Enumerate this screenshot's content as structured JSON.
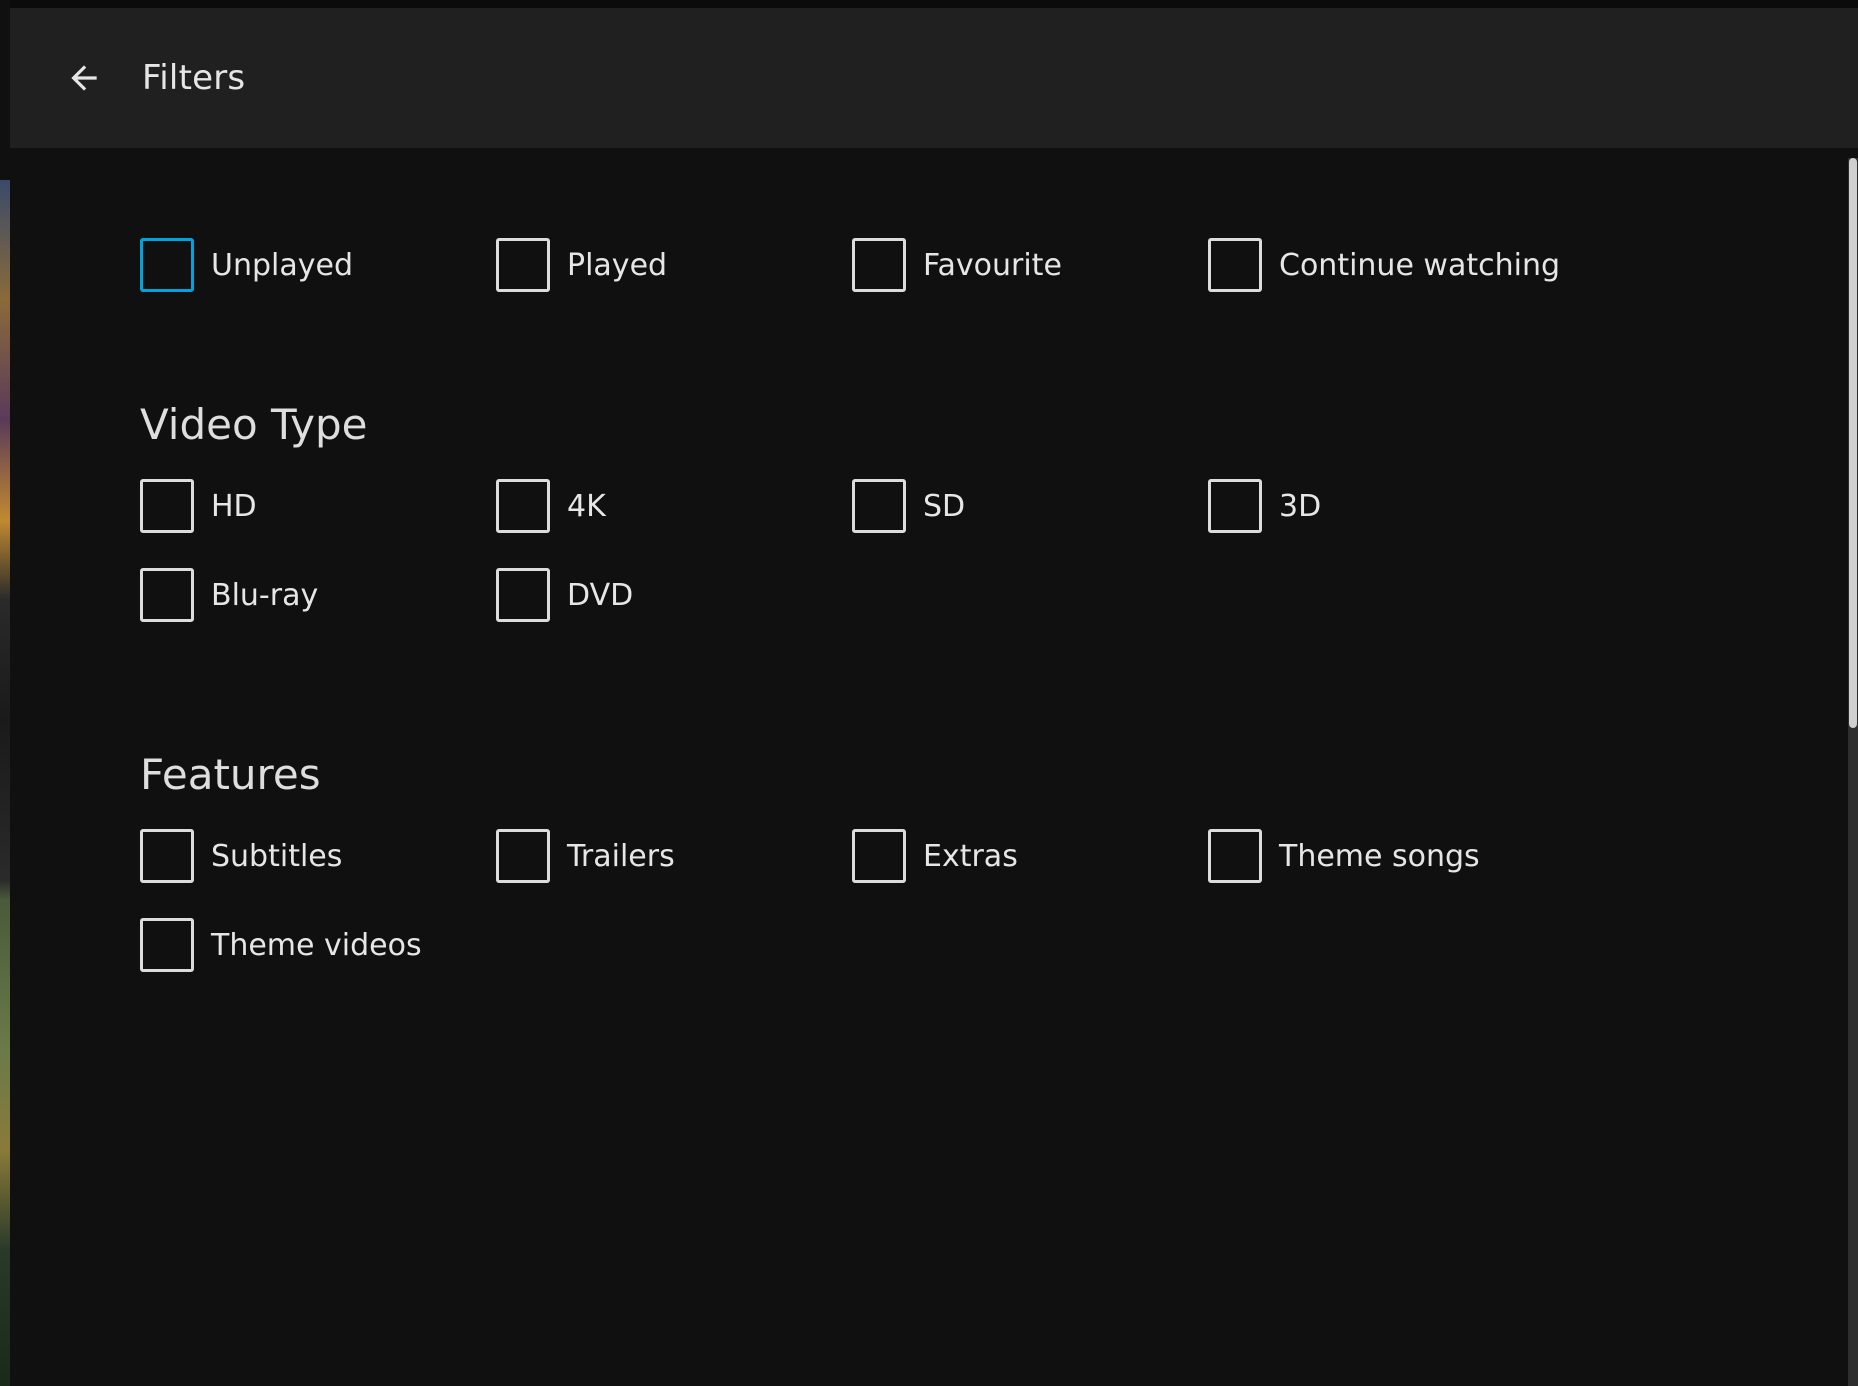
{
  "header": {
    "title": "Filters",
    "back_icon": "arrow-left-icon"
  },
  "status_filters": [
    {
      "label": "Unplayed",
      "checked": false,
      "focused": true
    },
    {
      "label": "Played",
      "checked": false
    },
    {
      "label": "Favourite",
      "checked": false
    },
    {
      "label": "Continue watching",
      "checked": false
    }
  ],
  "video_type": {
    "title": "Video Type",
    "items": [
      {
        "label": "HD",
        "checked": false
      },
      {
        "label": "4K",
        "checked": false
      },
      {
        "label": "SD",
        "checked": false
      },
      {
        "label": "3D",
        "checked": false
      },
      {
        "label": "Blu-ray",
        "checked": false
      },
      {
        "label": "DVD",
        "checked": false
      }
    ]
  },
  "features": {
    "title": "Features",
    "items": [
      {
        "label": "Subtitles",
        "checked": false
      },
      {
        "label": "Trailers",
        "checked": false
      },
      {
        "label": "Extras",
        "checked": false
      },
      {
        "label": "Theme songs",
        "checked": false
      },
      {
        "label": "Theme videos",
        "checked": false
      }
    ]
  },
  "colors": {
    "accent": "#00a4dc",
    "header_bg": "#202020",
    "dialog_bg": "#101010",
    "text": "#e6e6e6"
  }
}
